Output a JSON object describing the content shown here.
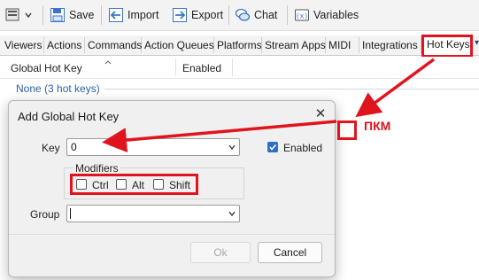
{
  "toolbar": {
    "save_label": "Save",
    "import_label": "Import",
    "export_label": "Export",
    "chat_label": "Chat",
    "variables_label": "Variables"
  },
  "tabs": [
    {
      "label": "Viewers"
    },
    {
      "label": "Actions"
    },
    {
      "label": "Commands"
    },
    {
      "label": "Action Queues"
    },
    {
      "label": "Platforms"
    },
    {
      "label": "Stream Apps"
    },
    {
      "label": "MIDI"
    },
    {
      "label": "Integrations"
    },
    {
      "label": "Hot Keys",
      "active": true
    }
  ],
  "table": {
    "columns": [
      "Global Hot Key",
      "Enabled"
    ],
    "group_label": "None (3 hot keys)"
  },
  "dialog": {
    "title": "Add Global Hot Key",
    "key_label": "Key",
    "key_value": "0",
    "enabled_label": "Enabled",
    "enabled_checked": true,
    "modifiers_label": "Modifiers",
    "modifiers": [
      {
        "label": "Ctrl",
        "checked": false
      },
      {
        "label": "Alt",
        "checked": false
      },
      {
        "label": "Shift",
        "checked": false
      }
    ],
    "group_label": "Group",
    "group_value": "",
    "ok_label": "Ok",
    "cancel_label": "Cancel"
  },
  "annotation": {
    "text": "ПКМ",
    "color": "#e0141e"
  }
}
